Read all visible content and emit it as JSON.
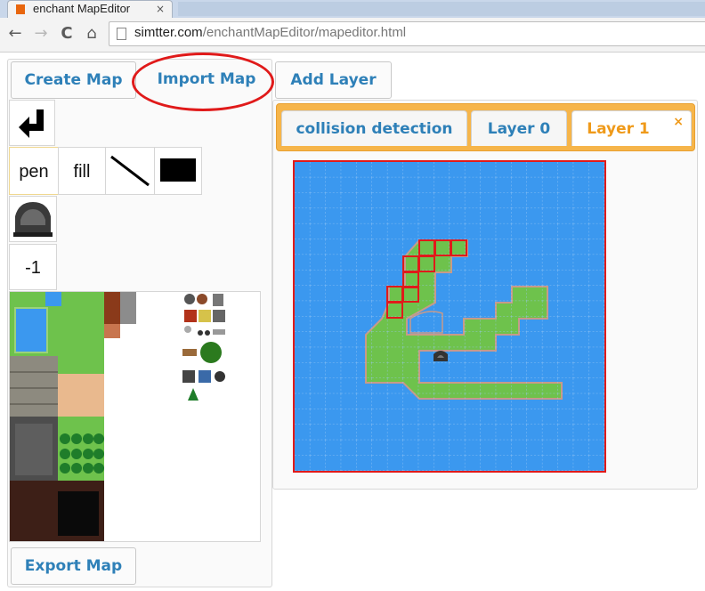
{
  "browser": {
    "tab_title": "enchant MapEditor",
    "tab_close": "×",
    "url_host": "simtter.com",
    "url_path": "/enchantMapEditor/mapeditor.html",
    "nav_back": "←",
    "nav_forward": "→",
    "nav_reload": "C",
    "nav_home": "⌂"
  },
  "toolbar": {
    "create_map": "Create Map",
    "import_map": "Import Map",
    "add_layer": "Add Layer",
    "export_map": "Export Map"
  },
  "tools": {
    "undo_icon": "undo-arrow-icon",
    "pen": "pen",
    "fill": "fill",
    "line_icon": "line-icon",
    "rect_icon": "rectangle-icon",
    "selected_tile_icon": "rock-tile-icon",
    "tile_index": "-1"
  },
  "layers": {
    "tabs": [
      {
        "label": "collision detection",
        "active": false
      },
      {
        "label": "Layer 0",
        "active": false
      },
      {
        "label": "Layer 1",
        "active": true
      }
    ],
    "close": "×"
  },
  "colors": {
    "water": "#3b98ef",
    "grass": "#6ec24c",
    "highlight": "#e01a1a",
    "accent_link": "#2e80b8",
    "accent_orange": "#f6b54a"
  }
}
